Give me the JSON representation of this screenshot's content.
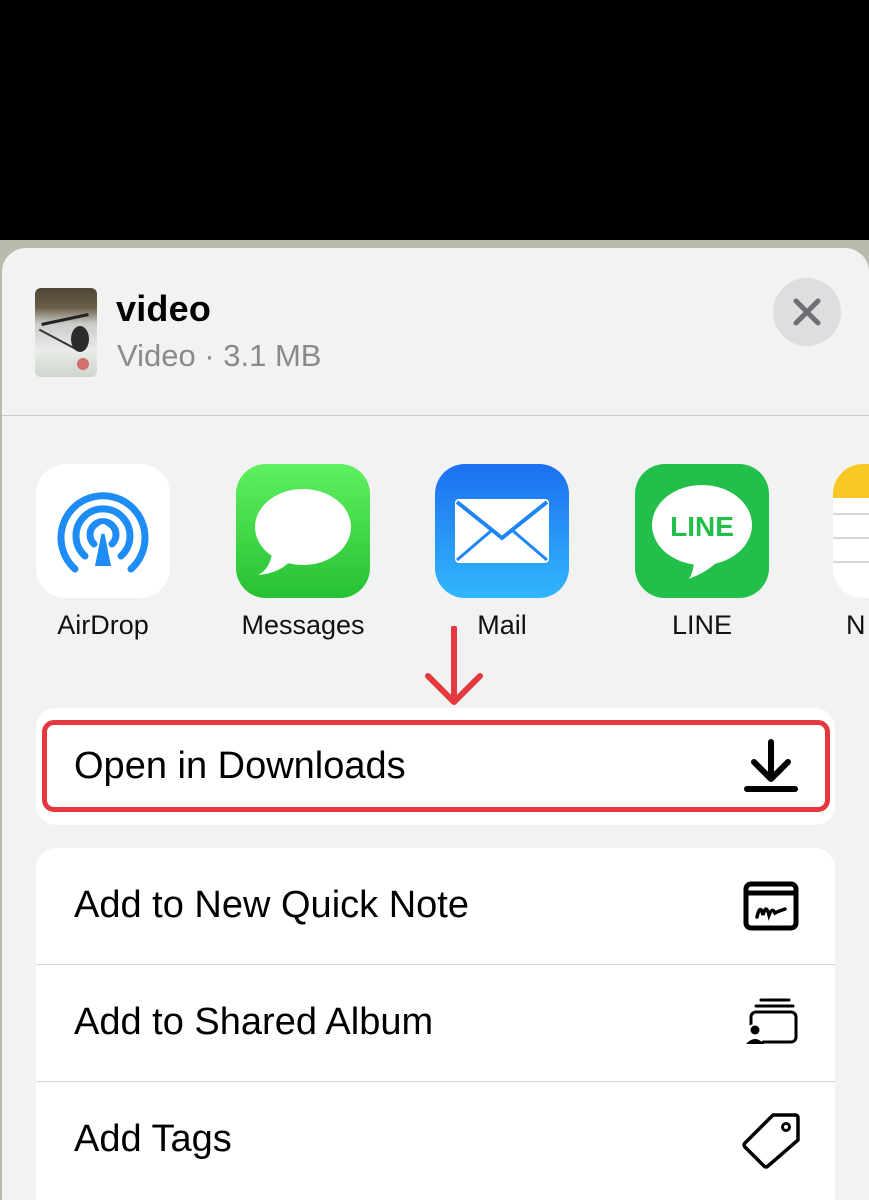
{
  "file": {
    "name": "video",
    "meta": "Video · 3.1 MB"
  },
  "apps": [
    {
      "label": "AirDrop",
      "icon": "airdrop-icon"
    },
    {
      "label": "Messages",
      "icon": "messages-icon"
    },
    {
      "label": "Mail",
      "icon": "mail-icon"
    },
    {
      "label": "LINE",
      "icon": "line-icon",
      "icon_text": "LINE"
    },
    {
      "label": "N",
      "icon": "notes-icon"
    }
  ],
  "actions": {
    "primary": {
      "label": "Open in Downloads",
      "icon": "download-icon"
    },
    "list": [
      {
        "label": "Add to New Quick Note",
        "icon": "quick-note-icon"
      },
      {
        "label": "Add to Shared Album",
        "icon": "shared-album-icon"
      },
      {
        "label": "Add Tags",
        "icon": "tag-icon"
      }
    ]
  },
  "colors": {
    "highlight": "#e5383f",
    "sheet_background": "#f2f2f2",
    "secondary_text": "#8a8a8e"
  }
}
